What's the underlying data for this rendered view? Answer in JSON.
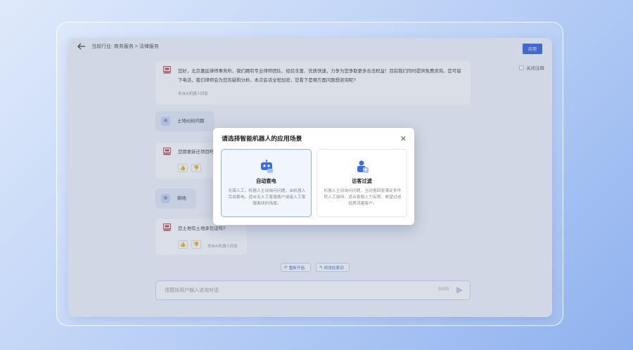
{
  "breadcrumb": "当前行业: 商务服务 > 法律服务",
  "apply_label": "应用",
  "close_annotation_label": "关闭注释",
  "messages": {
    "bot1_text": "您好，北京嘉廷律师事务所，我们拥有专业律师团队、经验丰富、优质快速，力争为您争取更多合法权益！目前我们同时提供免费咨询，您可留下电话，我们律师会为您答疑和分析。本次会话全程加密，您看下是哪方面问题想咨询呢?",
    "source_label": "来自AI机器人回复",
    "user1_text": "土地纠纷问题",
    "bot2_text": "您那要拆迁项目吗？",
    "user2_text": "耕地",
    "bot3_text": "您土地有土地承包证吗?"
  },
  "actions": {
    "restart_label": "重新开始",
    "edit_label": "修改检索词"
  },
  "input": {
    "placeholder": "请模拟用户输入咨询对话",
    "counter": "0/100"
  },
  "modal": {
    "title": "请选择智能机器人的应用场景",
    "cards": [
      {
        "title": "自动套电",
        "desc": "无需人工，机器人主动询问问题，由机器人完成套电，适合无人工客服客户或者人工客服离线的场景。",
        "icon": "robot-icon"
      },
      {
        "title": "访客过滤",
        "desc": "机器人主动询问问题，当访客回复满足条件转人工接待，适合客服人力有限，希望过滤低质流量客户。",
        "icon": "visitor-filter-icon"
      }
    ]
  },
  "colors": {
    "accent": "#2f5fdc",
    "background_gradient_end": "#8fb1ee"
  }
}
